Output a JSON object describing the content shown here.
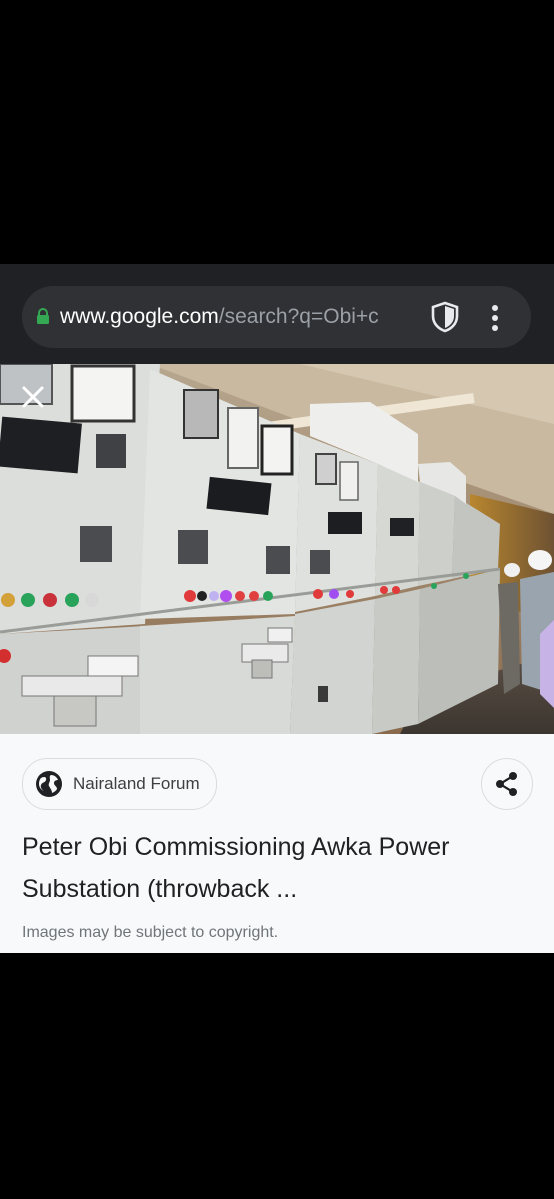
{
  "browser": {
    "url_main": "www.google.com",
    "url_path": "/search?q=Obi+c",
    "icons": [
      "lock-icon",
      "shield-icon",
      "more-vert-icon"
    ]
  },
  "viewer": {
    "close_icon": "close-icon",
    "image_alt_subject": "power substation switchgear panels"
  },
  "result": {
    "source": "Nairaland Forum",
    "title": "Peter Obi Commissioning Awka Power Substation (throwback ...",
    "copyright_note": "Images may be subject to copyright."
  },
  "colors": {
    "toolbar": "#202124",
    "urlbar": "#303134",
    "lock": "#34a853",
    "card": "#f8f9fa"
  }
}
